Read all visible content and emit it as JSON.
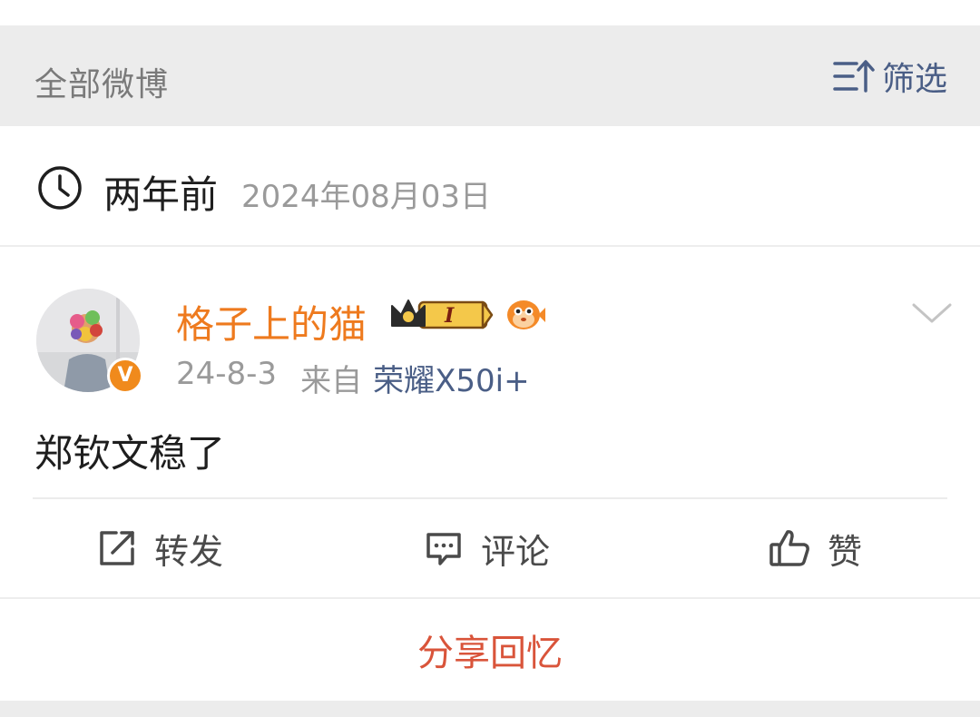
{
  "filter_bar": {
    "title": "全部微博",
    "filter_label": "筛选",
    "filter_icon": "sort-filter-icon"
  },
  "date_header": {
    "clock_icon": "clock-icon",
    "relative": "两年前",
    "absolute": "2024年08月03日"
  },
  "post": {
    "username": "格子上的猫",
    "verified_mark": "V",
    "badges": [
      "vip-crown-badge",
      "pufferfish-badge"
    ],
    "vip_level": "I",
    "date": "24-8-3",
    "from_prefix": "来自",
    "device": "荣耀X50i+",
    "text": "郑钦文稳了",
    "actions": {
      "repost": "转发",
      "comment": "评论",
      "like": "赞"
    }
  },
  "share": {
    "label": "分享回忆"
  },
  "colors": {
    "accent_orange": "#ee7a1e",
    "link_blue": "#4a5e86",
    "share_red": "#d9543a"
  }
}
